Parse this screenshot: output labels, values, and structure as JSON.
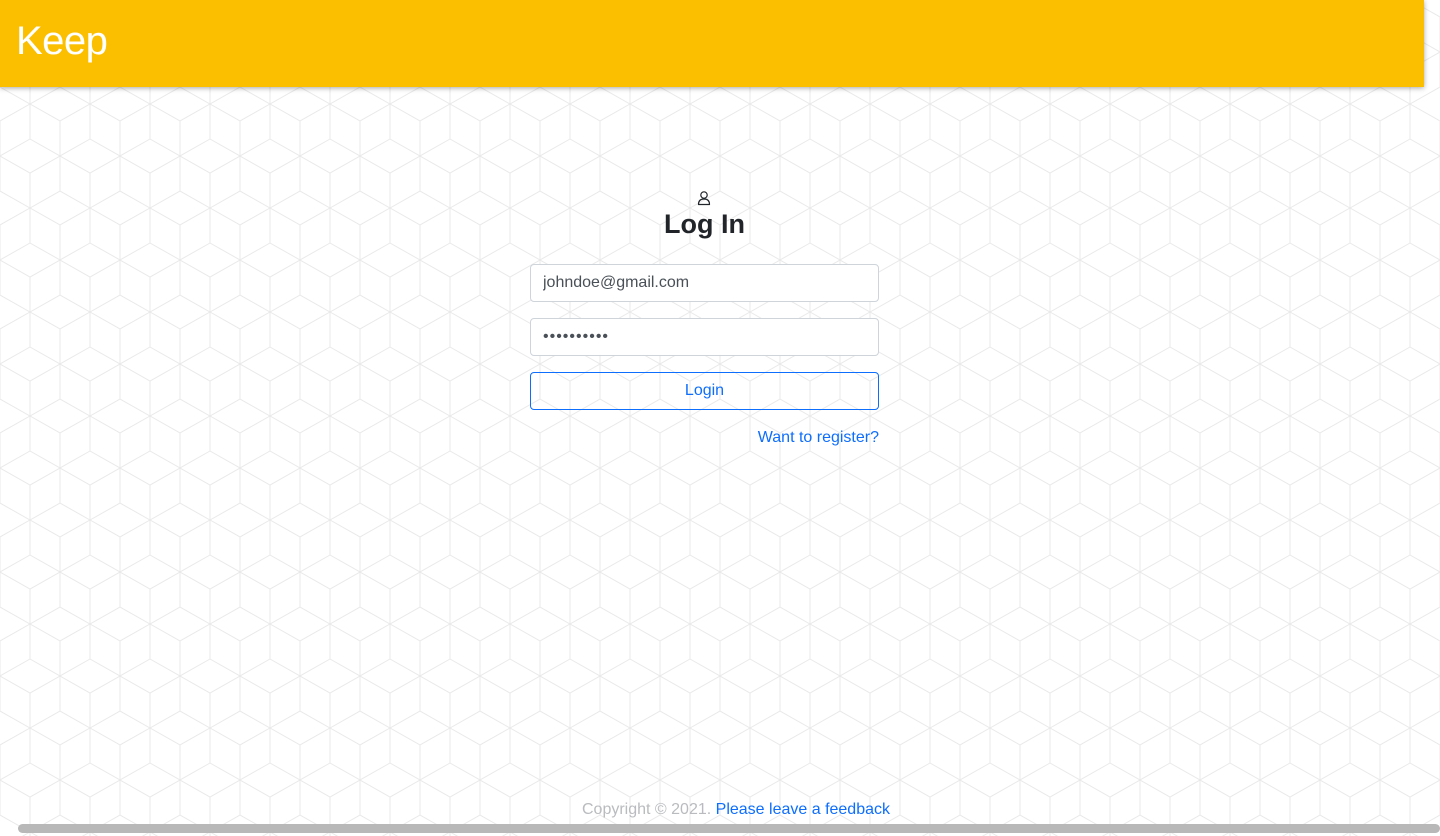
{
  "app": {
    "brand": "Keep",
    "accent_color": "#fbbf00",
    "link_color": "#0d6efd"
  },
  "login": {
    "icon": "user-icon",
    "title": "Log In",
    "email_value": "johndoe@gmail.com",
    "password_value": "••••••••••",
    "submit_label": "Login",
    "register_link": "Want to register?"
  },
  "footer": {
    "copyright": "Copyright © 2021.",
    "feedback_link": "Please leave a feedback"
  }
}
